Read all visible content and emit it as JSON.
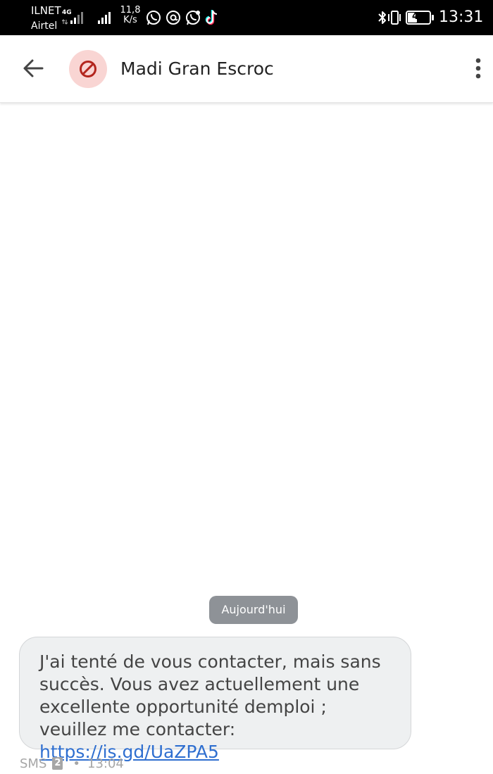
{
  "status_bar": {
    "carrier_1": "ILNET",
    "carrier_2": "Airtel",
    "network_type": "4G",
    "speed_value": "11,8",
    "speed_unit": "K/s",
    "battery_percent": 41,
    "battery_label": "41",
    "time": "13:31",
    "notification_icons": [
      "whatsapp-icon",
      "threads-icon",
      "whatsapp-business-icon",
      "tiktok-icon"
    ],
    "system_icons": [
      "bluetooth-icon",
      "vibrate-icon",
      "battery-icon"
    ]
  },
  "header": {
    "back_icon": "arrow-left-icon",
    "avatar_icon": "blocked-icon",
    "contact_name": "Madi Gran Escroc",
    "menu_icon": "more-vertical-icon"
  },
  "conversation": {
    "date_label": "Aujourd'hui",
    "messages": [
      {
        "text": "J'ai tenté de vous contacter, mais sans succès. Vous avez actuellement une excellente opportunité demploi ; veuillez me contacter: ",
        "link": "https://is.gd/UaZPA5",
        "channel": "SMS",
        "sim": "2",
        "separator": "•",
        "time": "13:04"
      }
    ]
  },
  "colors": {
    "status_bar_bg": "#000000",
    "avatar_bg": "#f9d5d3",
    "avatar_icon": "#b3261e",
    "bubble_bg": "#eef0f1",
    "link": "#2f6fd0",
    "date_chip_bg": "#8e9297"
  }
}
